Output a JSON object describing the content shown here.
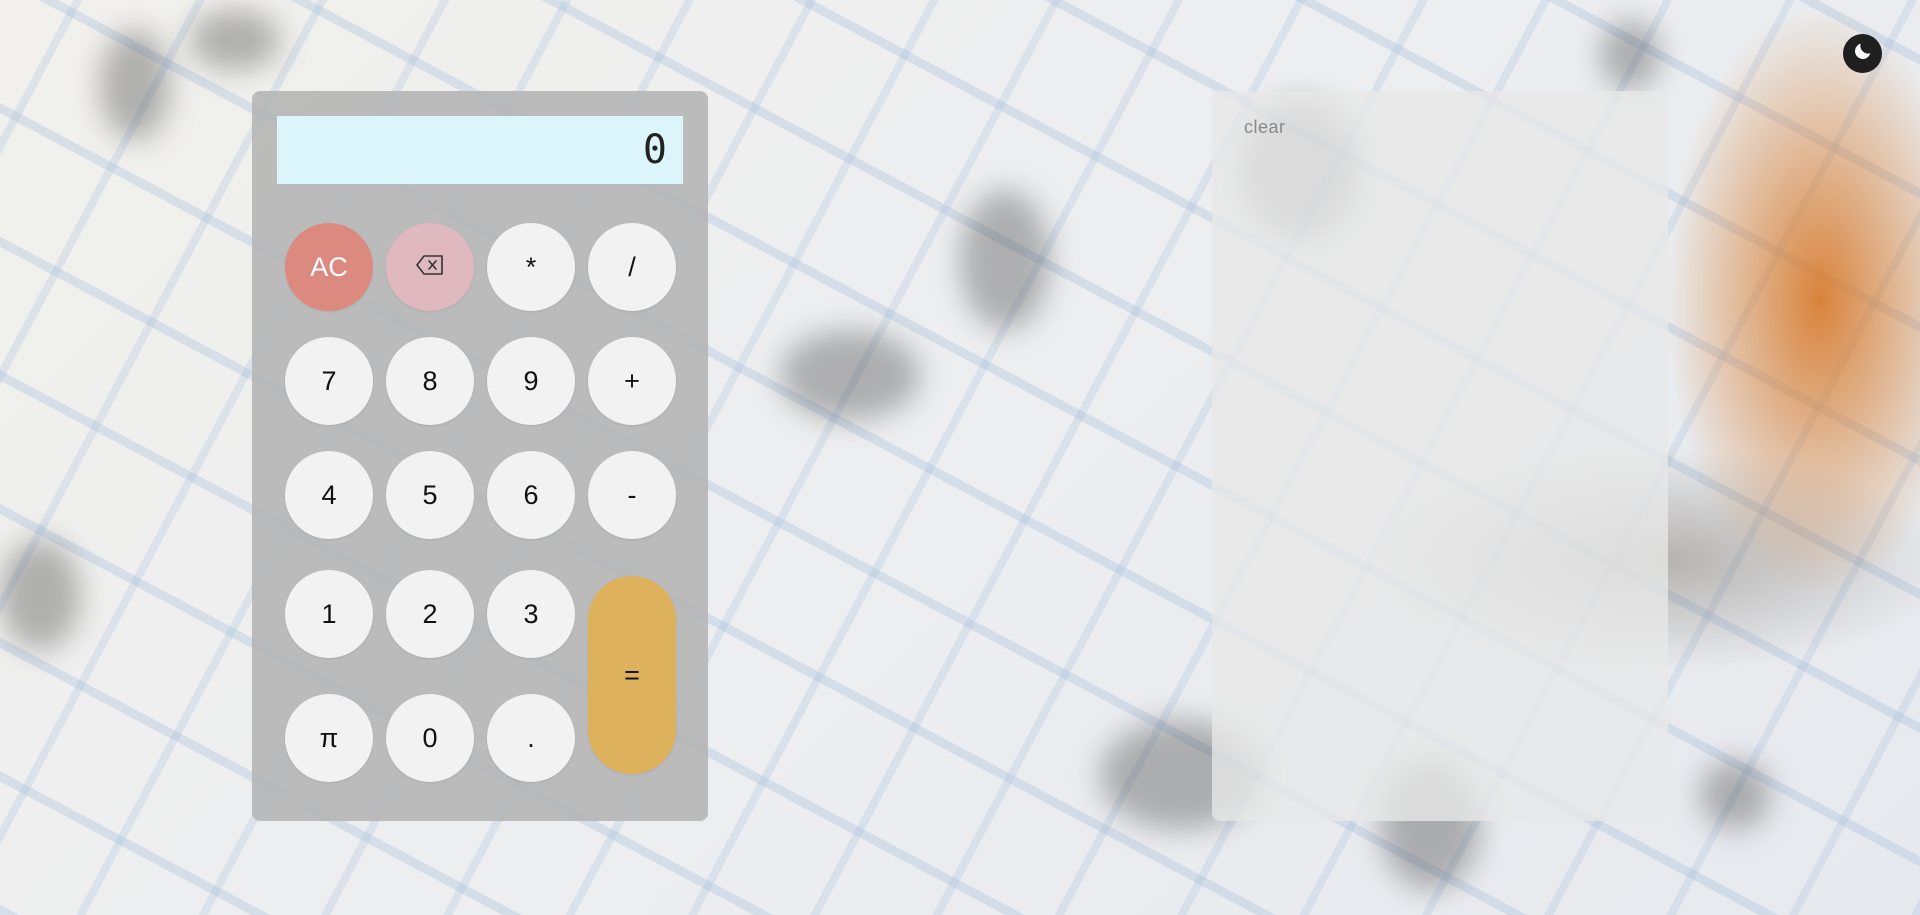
{
  "theme_toggle": {
    "icon": "moon-icon"
  },
  "display": {
    "value": "0"
  },
  "keys": {
    "ac": "AC",
    "backspace_icon": "backspace-icon",
    "multiply": "*",
    "divide": "/",
    "seven": "7",
    "eight": "8",
    "nine": "9",
    "plus": "+",
    "four": "4",
    "five": "5",
    "six": "6",
    "minus": "-",
    "one": "1",
    "two": "2",
    "three": "3",
    "equals": "=",
    "pi": "π",
    "zero": "0",
    "dot": "."
  },
  "history": {
    "clear_label": "clear"
  },
  "colors": {
    "display_bg": "#dcf5fa",
    "ac": "#dc8a80",
    "backspace": "#e0b9c0",
    "equals": "#deb25c",
    "key": "#f2f2f2",
    "toggle": "#1f1f1f"
  }
}
